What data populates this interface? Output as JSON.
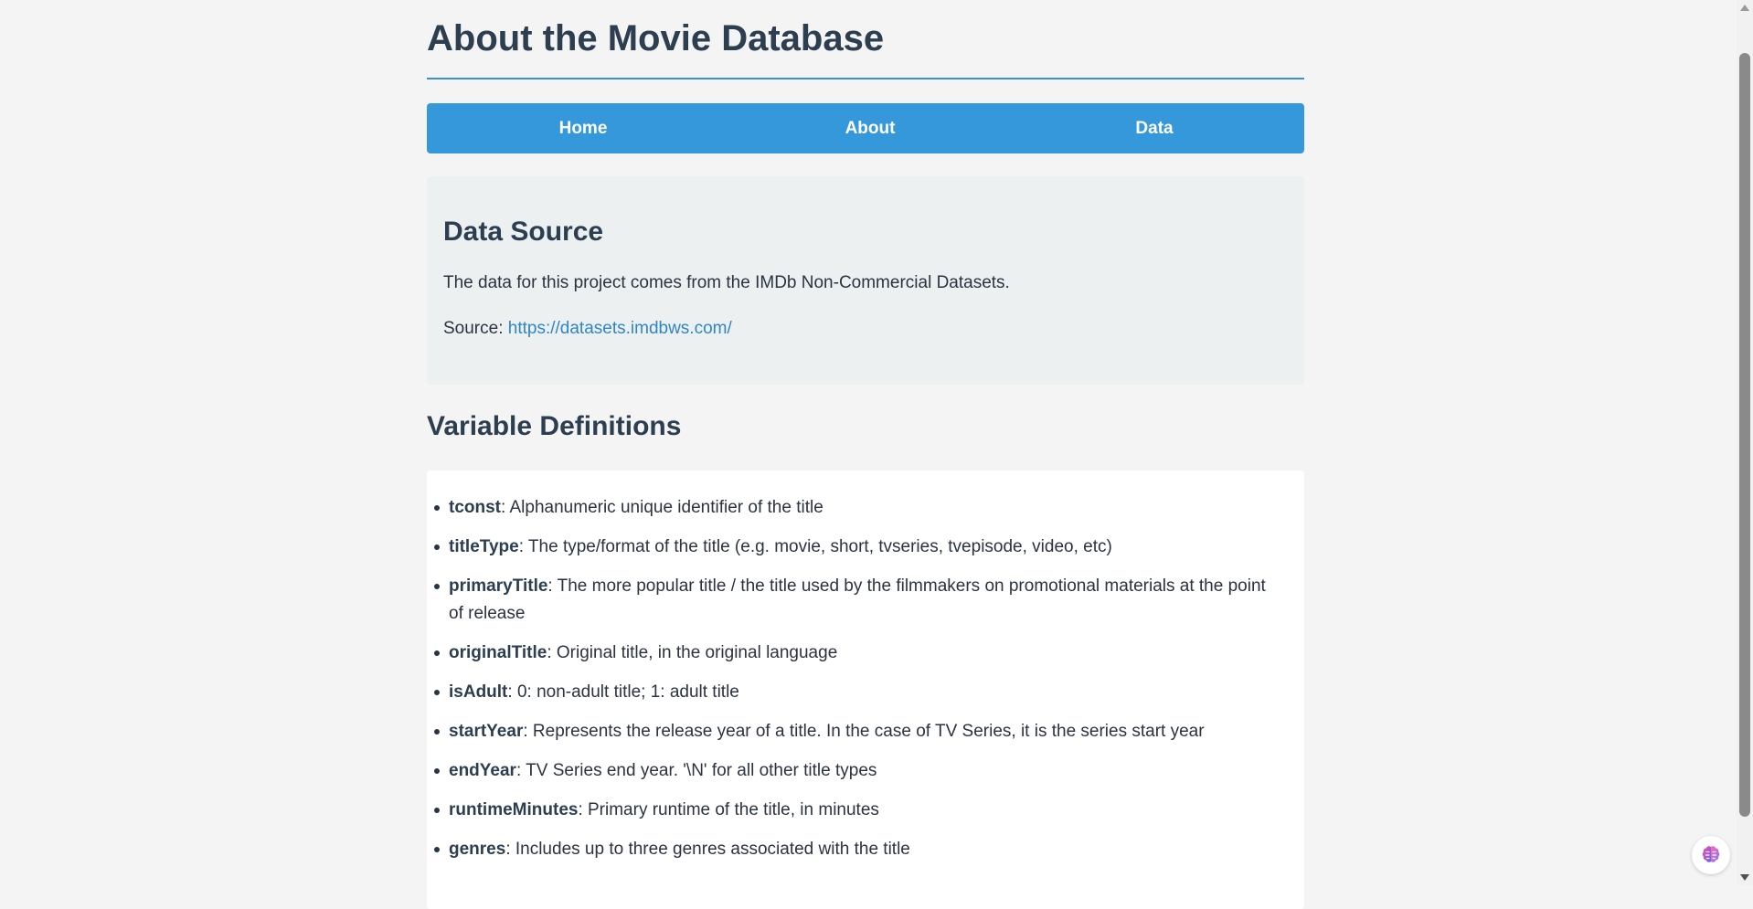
{
  "page": {
    "title": "About the Movie Database"
  },
  "nav": {
    "items": [
      {
        "label": "Home"
      },
      {
        "label": "About"
      },
      {
        "label": "Data"
      }
    ]
  },
  "data_source": {
    "heading": "Data Source",
    "description": "The data for this project comes from the IMDb Non-Commercial Datasets.",
    "source_prefix": "Source: ",
    "source_link": "https://datasets.imdbws.com/"
  },
  "variables": {
    "heading": "Variable Definitions",
    "items": [
      {
        "name": "tconst",
        "definition": ": Alphanumeric unique identifier of the title"
      },
      {
        "name": "titleType",
        "definition": ": The type/format of the title (e.g. movie, short, tvseries, tvepisode, video, etc)"
      },
      {
        "name": "primaryTitle",
        "definition": ": The more popular title / the title used by the filmmakers on promotional materials at the point of release"
      },
      {
        "name": "originalTitle",
        "definition": ": Original title, in the original language"
      },
      {
        "name": "isAdult",
        "definition": ": 0: non-adult title; 1: adult title"
      },
      {
        "name": "startYear",
        "definition": ": Represents the release year of a title. In the case of TV Series, it is the series start year"
      },
      {
        "name": "endYear",
        "definition": ": TV Series end year. '\\N' for all other title types"
      },
      {
        "name": "runtimeMinutes",
        "definition": ": Primary runtime of the title, in minutes"
      },
      {
        "name": "genres",
        "definition": ": Includes up to three genres associated with the title"
      }
    ]
  },
  "colors": {
    "accent": "#3498db",
    "heading": "#2c3e50",
    "link": "#2f86c6",
    "background": "#f4f4f4",
    "card_source": "#ecf0f1",
    "card_vars": "#ffffff"
  },
  "icons": {
    "floating_button": "brain-icon"
  }
}
